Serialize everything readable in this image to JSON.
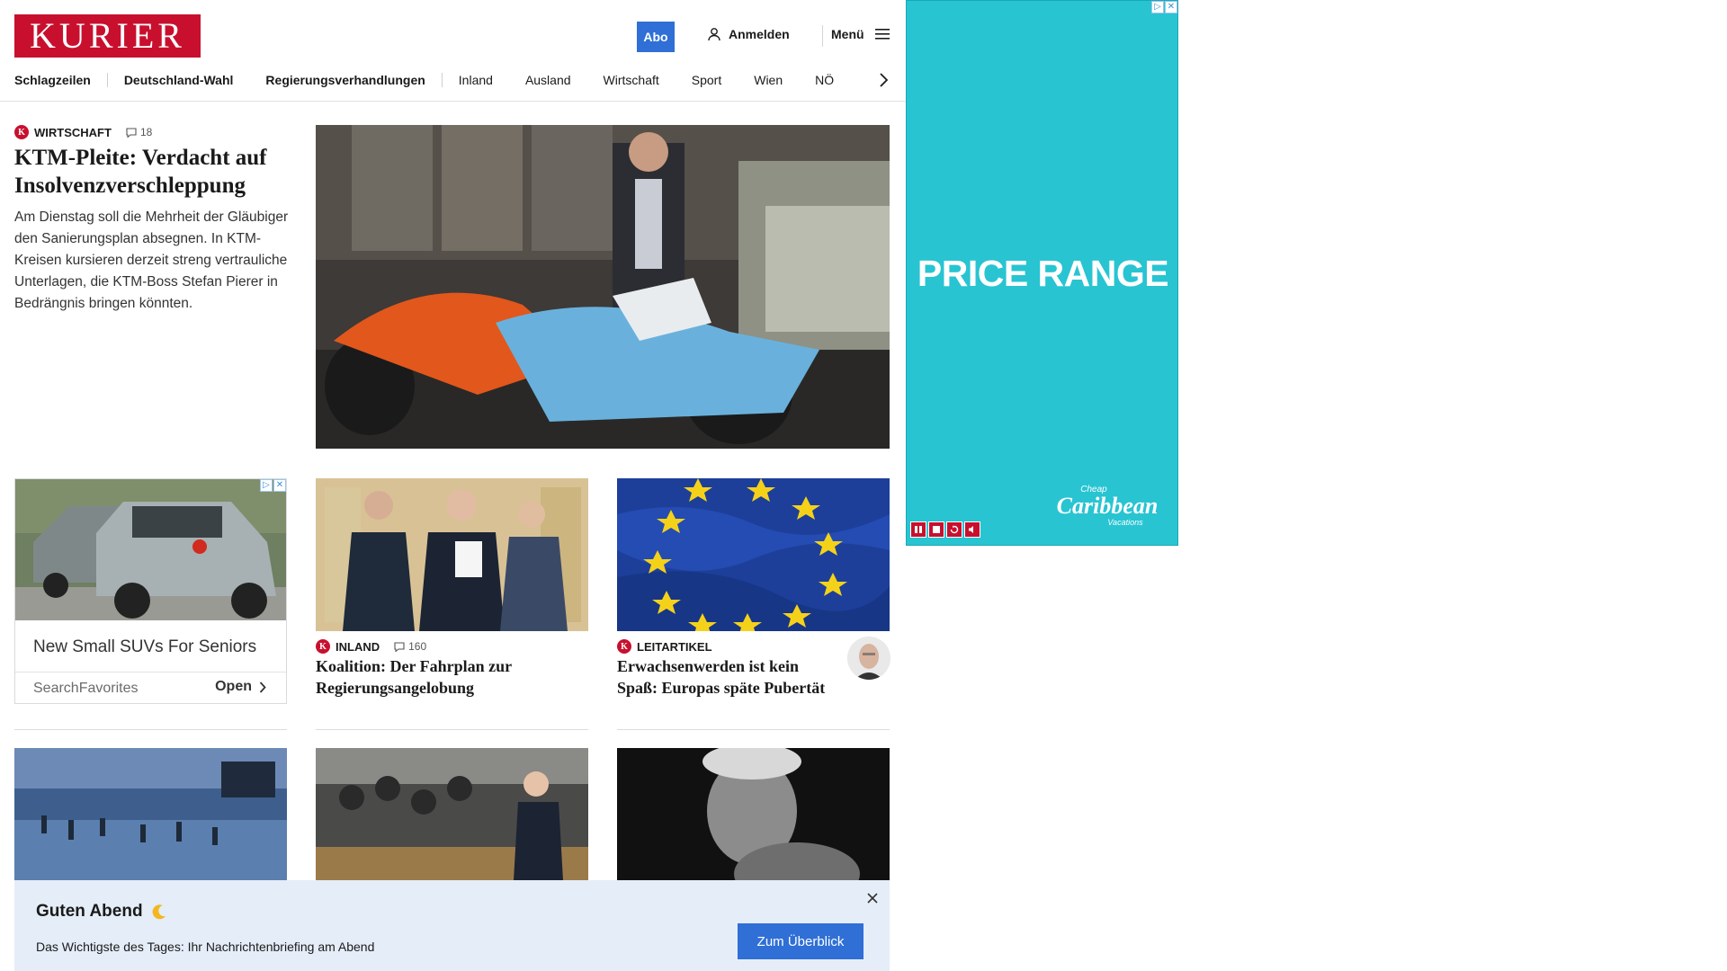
{
  "header": {
    "logo_text": "KURIER",
    "abo_label": "Abo",
    "login_label": "Anmelden",
    "menu_label": "Menü"
  },
  "nav": {
    "items": [
      "Schlagzeilen",
      "Deutschland-Wahl",
      "Regierungsverhandlungen",
      "Inland",
      "Ausland",
      "Wirtschaft",
      "Sport",
      "Wien",
      "NÖ"
    ]
  },
  "lead": {
    "kicker": "WIRTSCHAFT",
    "comments": "18",
    "title": "KTM-Pleite: Verdacht auf Insolvenzverschleppung",
    "teaser": "Am Dienstag soll die Mehrheit der Gläubiger den Sanierungsplan absegnen. In KTM-Kreisen kursieren derzeit streng vertrauliche Unterlagen, die KTM-Boss Stefan Pierer in Bedrängnis bringen könnten."
  },
  "ad_card": {
    "title": "New Small SUVs For Seniors",
    "source": "SearchFavorites",
    "open_label": "Open"
  },
  "articles": [
    {
      "kicker": "INLAND",
      "comments": "160",
      "title": "Koalition: Der Fahrplan zur Regierungsangelobung"
    },
    {
      "kicker": "LEITARTIKEL",
      "title": "Erwachsenwerden ist kein Spaß: Europas späte Pubertät"
    }
  ],
  "banner": {
    "title": "Guten Abend",
    "subtitle": "Das Wichtigste des Tages: Ihr Nachrichtenbriefing am Abend",
    "button": "Zum Überblick"
  },
  "side_ad": {
    "headline": "PRICE RANGE",
    "brand_top": "Cheap",
    "brand_main": "Caribbean",
    "brand_bottom": "Vacations",
    "background": "#28c4d2"
  },
  "colors": {
    "brand_red": "#c8102e",
    "accent_blue": "#2f6fd6",
    "banner_bg": "#e5edf8"
  }
}
